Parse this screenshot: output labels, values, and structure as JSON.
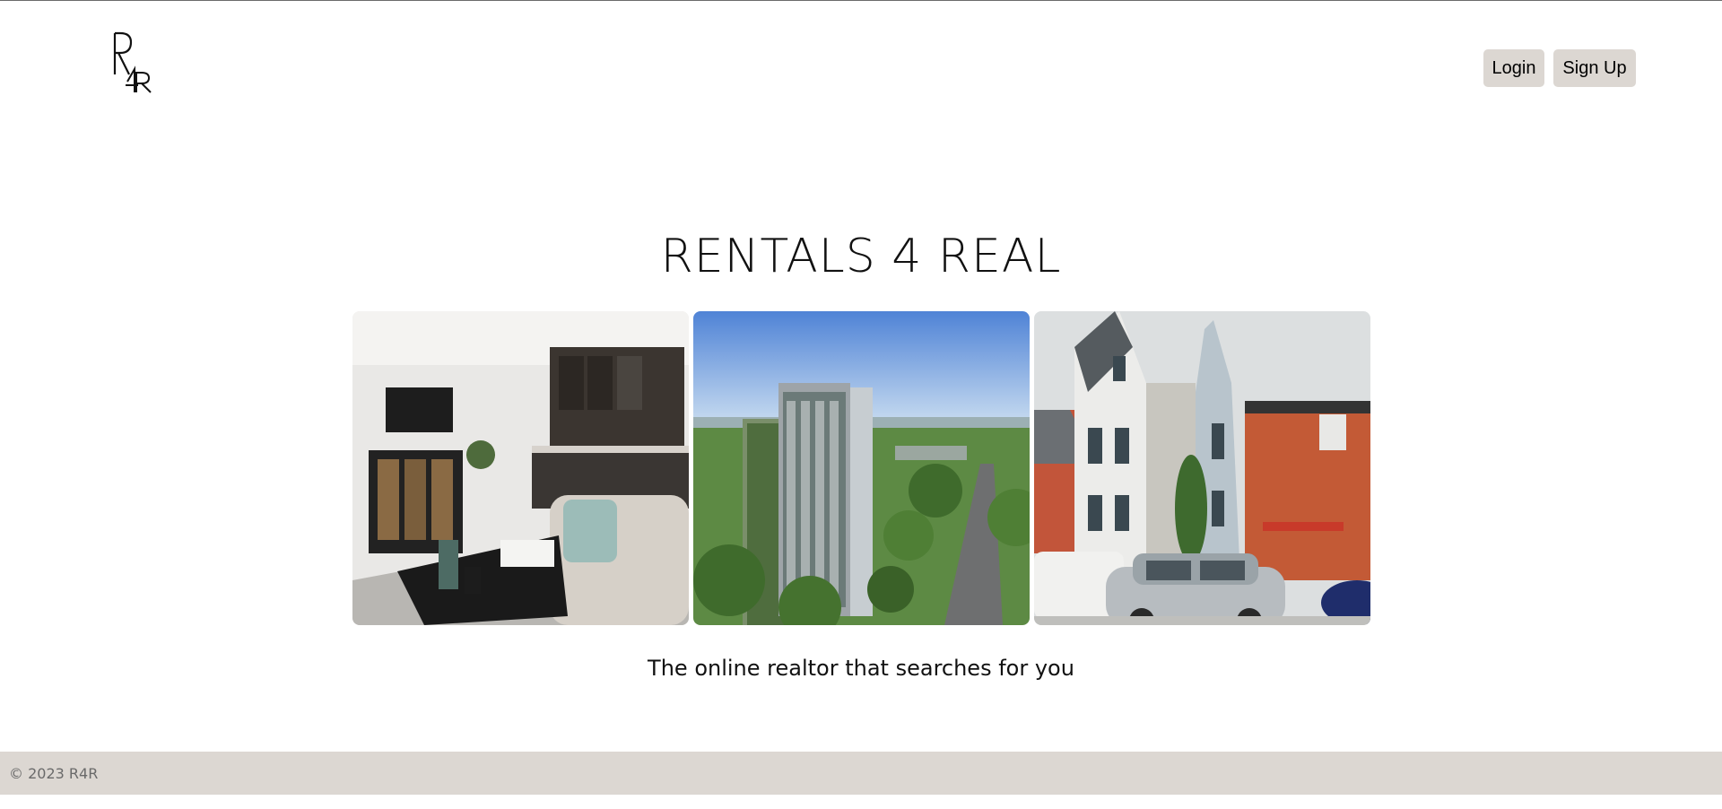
{
  "header": {
    "logo_text": "R4R",
    "login_label": "Login",
    "signup_label": "Sign Up"
  },
  "hero": {
    "title": "RENTALS 4 REAL",
    "tagline": "The online realtor that searches for you",
    "photos": [
      {
        "subject": "modern living room and kitchen interior"
      },
      {
        "subject": "high-rise residential tower over a green city"
      },
      {
        "subject": "row of victorian houses with parked cars"
      }
    ]
  },
  "footer": {
    "copyright": "© 2023 R4R"
  },
  "colors": {
    "button_bg": "#dcd7d2",
    "footer_bg": "#dcd7d2",
    "text": "#111111",
    "footer_text": "#6a6a6a"
  }
}
